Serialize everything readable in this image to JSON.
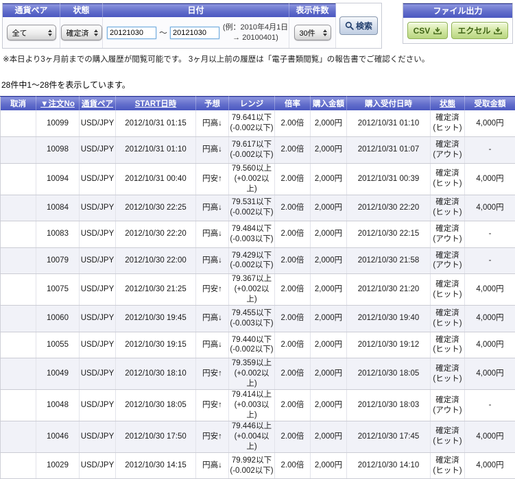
{
  "filters": {
    "currency_pair": {
      "label": "通貨ペア",
      "value": "全て"
    },
    "status": {
      "label": "状態",
      "value": "確定済"
    },
    "date": {
      "label": "日付",
      "from": "20121030",
      "to": "20121030",
      "tilde": "～",
      "example": "(例：2010年4月1日 → 20100401)"
    },
    "display_count": {
      "label": "表示件数",
      "value": "30件"
    },
    "search_label": "検索"
  },
  "file_output": {
    "label": "ファイル出力",
    "csv_label": "CSV",
    "excel_label": "エクセル"
  },
  "note": "※本日より3ヶ月前までの購入履歴が閲覧可能です。 3ヶ月以上前の履歴は「電子書類閲覧」の報告書でご確認ください。",
  "result_summary": "28件中1〜28件を表示しています。",
  "colors": {
    "header_blue": "#5560c4",
    "header_blue_dark": "#2a3490",
    "row_alt": "#f1f2f8",
    "button_green": "#c6e08e",
    "button_green_text": "#3f6415",
    "search_button_text": "#23406e",
    "date_input_border": "#76aede"
  },
  "table": {
    "headers": [
      {
        "label": "取消",
        "sortable": false
      },
      {
        "label": "▼注文No",
        "sortable": true
      },
      {
        "label": "通貨ペア",
        "sortable": true
      },
      {
        "label": "START日時",
        "sortable": true
      },
      {
        "label": "予想",
        "sortable": false
      },
      {
        "label": "レンジ",
        "sortable": false
      },
      {
        "label": "倍率",
        "sortable": false
      },
      {
        "label": "購入金額",
        "sortable": false
      },
      {
        "label": "購入受付日時",
        "sortable": false
      },
      {
        "label": "状態",
        "sortable": true
      },
      {
        "label": "受取金額",
        "sortable": false
      }
    ],
    "rows": [
      {
        "cancel": "",
        "order_no": "10099",
        "pair": "USD/JPY",
        "start": "2012/10/31 01:15",
        "forecast": "円高↓",
        "range1": "79.641以下",
        "range2": "(-0.002以下)",
        "multiplier": "2.00倍",
        "purchase": "2,000円",
        "accepted": "2012/10/31 01:10",
        "status1": "確定済",
        "status2": "(ヒット)",
        "payout": "4,000円"
      },
      {
        "cancel": "",
        "order_no": "10098",
        "pair": "USD/JPY",
        "start": "2012/10/31 01:10",
        "forecast": "円高↓",
        "range1": "79.617以下",
        "range2": "(-0.002以下)",
        "multiplier": "2.00倍",
        "purchase": "2,000円",
        "accepted": "2012/10/31 01:07",
        "status1": "確定済",
        "status2": "(アウト)",
        "payout": "-"
      },
      {
        "cancel": "",
        "order_no": "10094",
        "pair": "USD/JPY",
        "start": "2012/10/31 00:40",
        "forecast": "円安↑",
        "range1": "79.560以上",
        "range2": "(+0.002以上)",
        "multiplier": "2.00倍",
        "purchase": "2,000円",
        "accepted": "2012/10/31 00:39",
        "status1": "確定済",
        "status2": "(ヒット)",
        "payout": "4,000円"
      },
      {
        "cancel": "",
        "order_no": "10084",
        "pair": "USD/JPY",
        "start": "2012/10/30 22:25",
        "forecast": "円高↓",
        "range1": "79.531以下",
        "range2": "(-0.002以下)",
        "multiplier": "2.00倍",
        "purchase": "2,000円",
        "accepted": "2012/10/30 22:20",
        "status1": "確定済",
        "status2": "(ヒット)",
        "payout": "4,000円"
      },
      {
        "cancel": "",
        "order_no": "10083",
        "pair": "USD/JPY",
        "start": "2012/10/30 22:20",
        "forecast": "円高↓",
        "range1": "79.484以下",
        "range2": "(-0.003以下)",
        "multiplier": "2.00倍",
        "purchase": "2,000円",
        "accepted": "2012/10/30 22:15",
        "status1": "確定済",
        "status2": "(アウト)",
        "payout": "-"
      },
      {
        "cancel": "",
        "order_no": "10079",
        "pair": "USD/JPY",
        "start": "2012/10/30 22:00",
        "forecast": "円高↓",
        "range1": "79.429以下",
        "range2": "(-0.002以下)",
        "multiplier": "2.00倍",
        "purchase": "2,000円",
        "accepted": "2012/10/30 21:58",
        "status1": "確定済",
        "status2": "(アウト)",
        "payout": "-"
      },
      {
        "cancel": "",
        "order_no": "10075",
        "pair": "USD/JPY",
        "start": "2012/10/30 21:25",
        "forecast": "円安↑",
        "range1": "79.367以上",
        "range2": "(+0.002以上)",
        "multiplier": "2.00倍",
        "purchase": "2,000円",
        "accepted": "2012/10/30 21:20",
        "status1": "確定済",
        "status2": "(ヒット)",
        "payout": "4,000円"
      },
      {
        "cancel": "",
        "order_no": "10060",
        "pair": "USD/JPY",
        "start": "2012/10/30 19:45",
        "forecast": "円高↓",
        "range1": "79.455以下",
        "range2": "(-0.003以下)",
        "multiplier": "2.00倍",
        "purchase": "2,000円",
        "accepted": "2012/10/30 19:40",
        "status1": "確定済",
        "status2": "(ヒット)",
        "payout": "4,000円"
      },
      {
        "cancel": "",
        "order_no": "10055",
        "pair": "USD/JPY",
        "start": "2012/10/30 19:15",
        "forecast": "円高↓",
        "range1": "79.440以下",
        "range2": "(-0.002以下)",
        "multiplier": "2.00倍",
        "purchase": "2,000円",
        "accepted": "2012/10/30 19:12",
        "status1": "確定済",
        "status2": "(ヒット)",
        "payout": "4,000円"
      },
      {
        "cancel": "",
        "order_no": "10049",
        "pair": "USD/JPY",
        "start": "2012/10/30 18:10",
        "forecast": "円安↑",
        "range1": "79.359以上",
        "range2": "(+0.002以上)",
        "multiplier": "2.00倍",
        "purchase": "2,000円",
        "accepted": "2012/10/30 18:05",
        "status1": "確定済",
        "status2": "(ヒット)",
        "payout": "4,000円"
      },
      {
        "cancel": "",
        "order_no": "10048",
        "pair": "USD/JPY",
        "start": "2012/10/30 18:05",
        "forecast": "円安↑",
        "range1": "79.414以上",
        "range2": "(+0.003以上)",
        "multiplier": "2.00倍",
        "purchase": "2,000円",
        "accepted": "2012/10/30 18:03",
        "status1": "確定済",
        "status2": "(アウト)",
        "payout": "-"
      },
      {
        "cancel": "",
        "order_no": "10046",
        "pair": "USD/JPY",
        "start": "2012/10/30 17:50",
        "forecast": "円安↑",
        "range1": "79.446以上",
        "range2": "(+0.004以上)",
        "multiplier": "2.00倍",
        "purchase": "2,000円",
        "accepted": "2012/10/30 17:45",
        "status1": "確定済",
        "status2": "(ヒット)",
        "payout": "4,000円"
      },
      {
        "cancel": "",
        "order_no": "10029",
        "pair": "USD/JPY",
        "start": "2012/10/30 14:15",
        "forecast": "円高↓",
        "range1": "79.992以下",
        "range2": "(-0.002以下)",
        "multiplier": "2.00倍",
        "purchase": "2,000円",
        "accepted": "2012/10/30 14:10",
        "status1": "確定済",
        "status2": "(ヒット)",
        "payout": "4,000円"
      }
    ]
  }
}
